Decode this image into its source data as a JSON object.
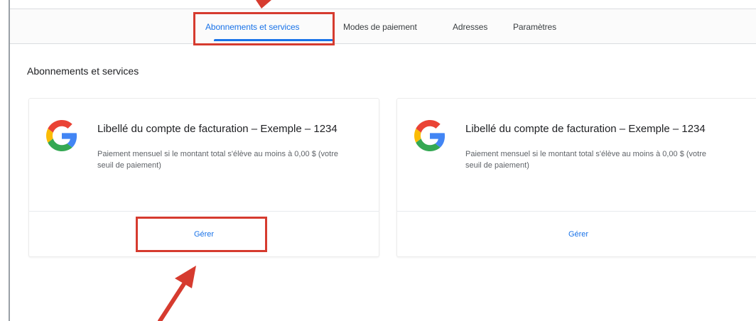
{
  "tabs": [
    {
      "label": "Abonnements et services"
    },
    {
      "label": "Modes de paiement"
    },
    {
      "label": "Adresses"
    },
    {
      "label": "Paramètres"
    }
  ],
  "section_title": "Abonnements et services",
  "cards": [
    {
      "title": "Libellé du compte de facturation – Exemple – 1234",
      "description": "Paiement mensuel si le montant total s'élève au moins à 0,00 $ (votre seuil de paiement)",
      "action_label": "Gérer"
    },
    {
      "title": "Libellé du compte de facturation – Exemple – 1234",
      "description": "Paiement mensuel si le montant total s'élève au moins à 0,00 $ (votre seuil de paiement)",
      "action_label": "Gérer"
    }
  ],
  "colors": {
    "accent": "#1a73e8",
    "annotation": "#d63b2f"
  },
  "icons": {
    "card_logo": "google-g-icon",
    "annotation": "red-arrow-icon"
  }
}
